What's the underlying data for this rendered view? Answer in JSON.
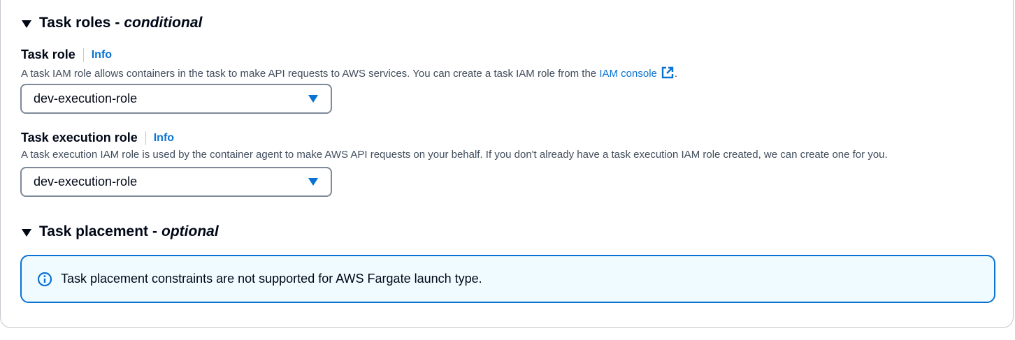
{
  "task_roles_section": {
    "title": "Task roles",
    "separator": "-",
    "qualifier": "conditional"
  },
  "task_role": {
    "label": "Task role",
    "info_label": "Info",
    "description_prefix": "A task IAM role allows containers in the task to make API requests to AWS services. You can create a task IAM role from the",
    "console_link": "IAM console",
    "description_suffix": ".",
    "selected_value": "dev-execution-role"
  },
  "task_execution_role": {
    "label": "Task execution role",
    "info_label": "Info",
    "description": "A task execution IAM role is used by the container agent to make AWS API requests on your behalf. If you don't already have a task execution IAM role created, we can create one for you.",
    "selected_value": "dev-execution-role"
  },
  "task_placement_section": {
    "title": "Task placement",
    "separator": "-",
    "qualifier": "optional"
  },
  "placement_alert": {
    "message": "Task placement constraints are not supported for AWS Fargate launch type.",
    "icon": "info-circle-icon"
  },
  "colors": {
    "link": "#0972d3",
    "alert_background": "#f0fbff",
    "alert_border": "#0972d3",
    "text": "#000716",
    "muted_text": "#414d5c"
  }
}
